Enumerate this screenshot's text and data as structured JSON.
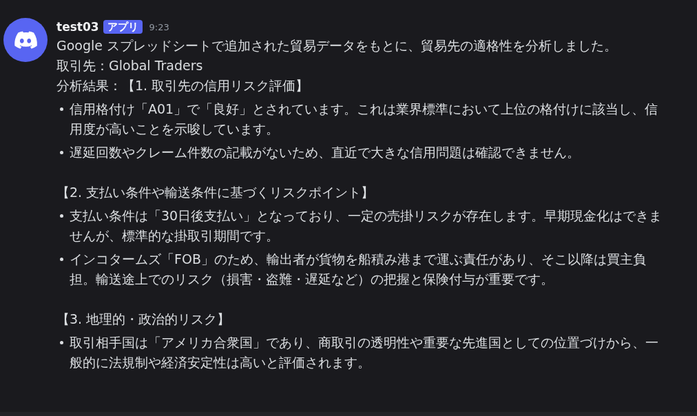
{
  "message": {
    "author": "test03",
    "badge": "アプリ",
    "time": "9:23",
    "lines": [
      "Google スプレッドシートで追加された貿易データをもとに、貿易先の適格性を分析しました。",
      "取引先：Global Traders"
    ],
    "sections": [
      {
        "heading": "分析結果：【1. 取引先の信用リスク評価】",
        "bullets": [
          "信用格付け「A01」で「良好」とされています。これは業界標準において上位の格付けに該当し、信用度が高いことを示唆しています。",
          "遅延回数やクレーム件数の記載がないため、直近で大きな信用問題は確認できません。"
        ]
      },
      {
        "heading": "【2. 支払い条件や輸送条件に基づくリスクポイント】",
        "bullets": [
          "支払い条件は「30日後支払い」となっており、一定の売掛リスクが存在します。早期現金化はできませんが、標準的な掛取引期間です。",
          "インコタームズ「FOB」のため、輸出者が貨物を船積み港まで運ぶ責任があり、そこ以降は買主負担。輸送途上でのリスク（損害・盗難・遅延など）の把握と保険付与が重要です。"
        ]
      },
      {
        "heading": "【3. 地理的・政治的リスク】",
        "bullets": [
          "取引相手国は「アメリカ合衆国」であり、商取引の透明性や重要な先進国としての位置づけから、一般的に法規制や経済安定性は高いと評価されます。"
        ]
      }
    ]
  }
}
